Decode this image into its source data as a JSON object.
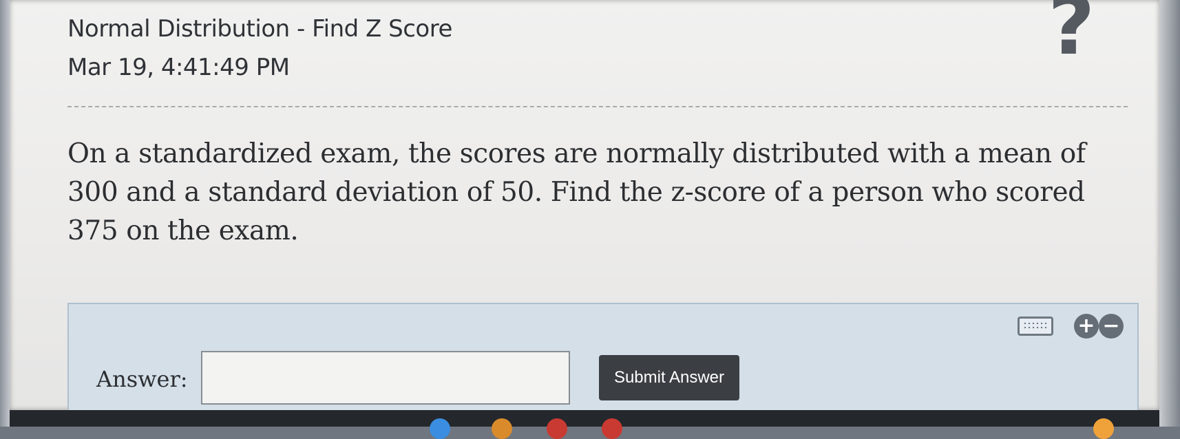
{
  "header": {
    "title": "Normal Distribution - Find Z Score",
    "timestamp": "Mar 19, 4:41:49 PM",
    "help_symbol": "?"
  },
  "question": {
    "text": "On a standardized exam, the scores are normally distributed with a mean of 300 and a standard deviation of 50. Find the z-score of a person who scored 375 on the exam."
  },
  "answer_panel": {
    "label": "Answer:",
    "input_value": "",
    "submit_label": "Submit Answer",
    "plus_symbol": "+",
    "minus_symbol": "−",
    "icons": [
      "keyboard-icon",
      "plus-circle-icon",
      "minus-circle-icon"
    ]
  },
  "colors": {
    "panel_background": "#d4dfe8",
    "submit_button": "#3b3f44",
    "text": "#2c2e31"
  }
}
